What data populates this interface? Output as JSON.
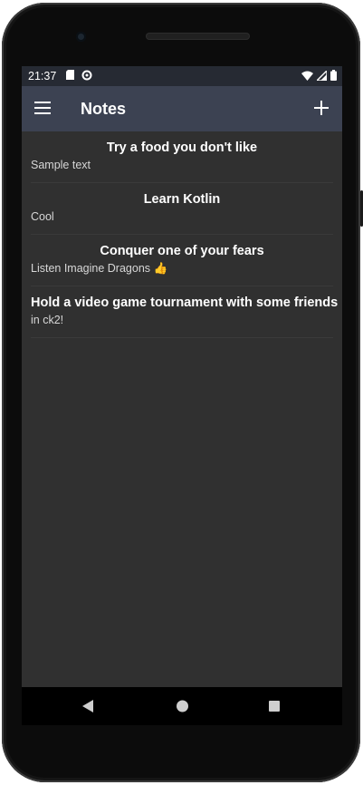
{
  "status_bar": {
    "time": "21:37"
  },
  "app_bar": {
    "title": "Notes"
  },
  "notes": [
    {
      "title": "Try a food you don't like",
      "body": "Sample text"
    },
    {
      "title": "Learn Kotlin",
      "body": "Cool"
    },
    {
      "title": "Conquer one of your fears",
      "body": "Listen Imagine Dragons 👍"
    },
    {
      "title": "Hold a video game tournament with some friends",
      "body": "in ck2!"
    }
  ],
  "icons": {
    "menu": "hamburger-menu-icon",
    "add": "plus-icon",
    "back": "back-triangle-icon",
    "home": "home-circle-icon",
    "recents": "recents-square-icon"
  },
  "colors": {
    "status_bar": "#262a33",
    "app_bar": "#3c4252",
    "background": "#303030"
  }
}
